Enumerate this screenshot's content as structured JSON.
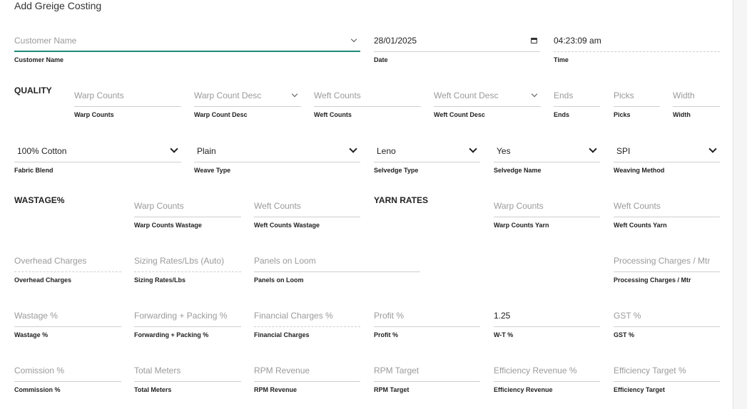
{
  "page_title": "Add Greige Costing",
  "top": {
    "customer": {
      "placeholder": "Customer Name",
      "label": "Customer Name"
    },
    "date": {
      "value": "28/01/2025",
      "label": "Date"
    },
    "time": {
      "value": "04:23:09 am",
      "label": "Time"
    }
  },
  "quality": {
    "heading": "QUALITY",
    "warp_counts": {
      "placeholder": "Warp Counts",
      "label": "Warp Counts"
    },
    "warp_count_desc": {
      "placeholder": "Warp Count Desc",
      "label": "Warp Count Desc"
    },
    "weft_counts": {
      "placeholder": "Weft Counts",
      "label": "Weft Counts"
    },
    "weft_count_desc": {
      "placeholder": "Weft Count Desc",
      "label": "Weft Count Desc"
    },
    "ends": {
      "placeholder": "Ends",
      "label": "Ends"
    },
    "picks": {
      "placeholder": "Picks",
      "label": "Picks"
    },
    "width": {
      "placeholder": "Width",
      "label": "Width"
    }
  },
  "fabric": {
    "fabric_blend": {
      "value": "100% Cotton",
      "label": "Fabric Blend"
    },
    "weave_type": {
      "value": "Plain",
      "label": "Weave Type"
    },
    "selvedge_type": {
      "value": "Leno",
      "label": "Selvedge Type"
    },
    "selvedge_name": {
      "value": "Yes",
      "label": "Selvedge Name"
    },
    "weaving_method": {
      "value": "SPI",
      "label": "Weaving Method"
    }
  },
  "wastage": {
    "heading": "WASTAGE%",
    "warp_counts": {
      "placeholder": "Warp Counts",
      "label": "Warp Counts Wastage"
    },
    "weft_counts": {
      "placeholder": "Weft Counts",
      "label": "Weft Counts Wastage"
    }
  },
  "yarn_rates": {
    "heading": "YARN RATES",
    "warp_counts": {
      "placeholder": "Warp Counts",
      "label": "Warp Counts Yarn"
    },
    "weft_counts": {
      "placeholder": "Weft Counts",
      "label": "Weft Counts Yarn"
    }
  },
  "charges": {
    "overhead": {
      "placeholder": "Overhead Charges",
      "label": "Overhead Charges"
    },
    "sizing": {
      "placeholder": "Sizing Rates/Lbs (Auto)",
      "label": "Sizing Rates/Lbs"
    },
    "panels": {
      "placeholder": "Panels on Loom",
      "label": "Panels on Loom"
    },
    "processing": {
      "placeholder": "Processing Charges / Mtr",
      "label": "Processing Charges / Mtr"
    }
  },
  "percentages": {
    "wastage": {
      "placeholder": "Wastage %",
      "label": "Wastage %"
    },
    "forwarding": {
      "placeholder": "Forwarding + Packing %",
      "label": "Forwarding + Packing %"
    },
    "financial": {
      "placeholder": "Financial Charges %",
      "label": "Financial Charges"
    },
    "profit": {
      "placeholder": "Profit %",
      "label": "Profit %"
    },
    "wt": {
      "value": "1.25",
      "label": "W-T %"
    },
    "gst": {
      "placeholder": "GST %",
      "label": "GST %"
    }
  },
  "targets": {
    "commission": {
      "placeholder": "Comission %",
      "label": "Commission %"
    },
    "total_meters": {
      "placeholder": "Total Meters",
      "label": "Total Meters"
    },
    "rpm_revenue": {
      "placeholder": "RPM Revenue",
      "label": "RPM Revenue"
    },
    "rpm_target": {
      "placeholder": "RPM Target",
      "label": "RPM Target"
    },
    "efficiency_revenue": {
      "placeholder": "Efficiency Revenue %",
      "label": "Efficiency Revenue"
    },
    "efficiency_target": {
      "placeholder": "Efficiency Target %",
      "label": "Efficiency Target"
    }
  }
}
